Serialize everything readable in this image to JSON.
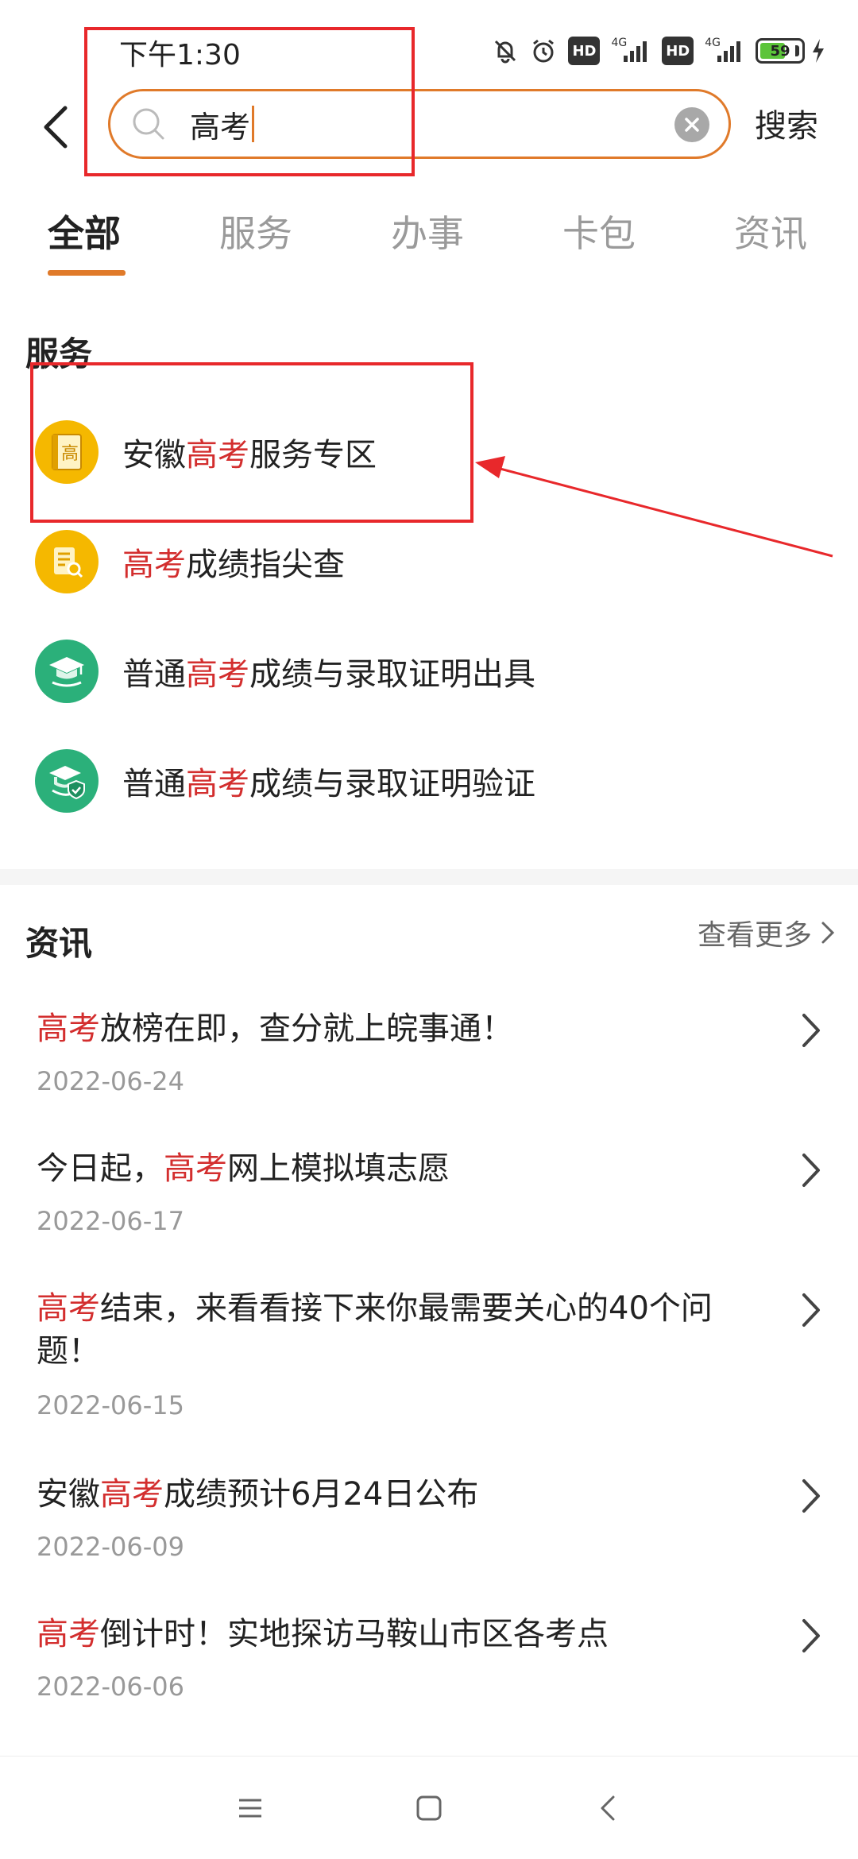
{
  "status_bar": {
    "time": "下午1:30",
    "network_label_1": "4G",
    "network_label_2": "4G",
    "hd_1": "HD",
    "hd_2": "HD",
    "battery": "59"
  },
  "search": {
    "query": "高考",
    "submit_label": "搜索"
  },
  "tabs": [
    {
      "label": "全部",
      "active": true
    },
    {
      "label": "服务",
      "active": false
    },
    {
      "label": "办事",
      "active": false
    },
    {
      "label": "卡包",
      "active": false
    },
    {
      "label": "资讯",
      "active": false
    }
  ],
  "services": {
    "title": "服务",
    "items": [
      {
        "pre": "安徽",
        "hl": "高考",
        "post": "服务专区",
        "icon": "book-icon",
        "icon_glyph": "高"
      },
      {
        "pre": "",
        "hl": "高考",
        "post": "成绩指尖查",
        "icon": "document-search-icon"
      },
      {
        "pre": "普通",
        "hl": "高考",
        "post": "成绩与录取证明出具",
        "icon": "graduation-cap-icon"
      },
      {
        "pre": "普通",
        "hl": "高考",
        "post": "成绩与录取证明验证",
        "icon": "graduation-shield-icon"
      }
    ]
  },
  "news": {
    "title": "资讯",
    "more_label": "查看更多",
    "items": [
      {
        "pre": "",
        "hl": "高考",
        "post": "放榜在即，查分就上皖事通！",
        "date": "2022-06-24"
      },
      {
        "pre": "今日起，",
        "hl": "高考",
        "post": "网上模拟填志愿",
        "date": "2022-06-17"
      },
      {
        "pre": "",
        "hl": "高考",
        "post": "结束，来看看接下来你最需要关心的40个问题！",
        "date": "2022-06-15"
      },
      {
        "pre": "安徽",
        "hl": "高考",
        "post": "成绩预计6月24日公布",
        "date": "2022-06-09"
      },
      {
        "pre": "",
        "hl": "高考",
        "post": "倒计时！实地探访马鞍山市区各考点",
        "date": "2022-06-06"
      }
    ]
  },
  "colors": {
    "accent": "#e07a2a",
    "highlight_text": "#d32e2e",
    "annotation": "#e8282b",
    "icon_yellow": "#f5b800",
    "icon_green": "#2bb07a"
  }
}
